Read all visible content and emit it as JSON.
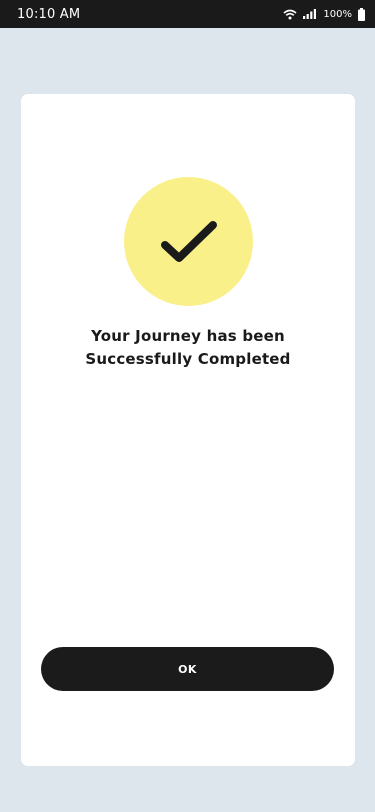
{
  "status_bar": {
    "time": "10:10 AM",
    "battery_percent": "100%",
    "icons": [
      "wifi-icon",
      "signal-icon",
      "battery-icon"
    ]
  },
  "card": {
    "icon": "checkmark-icon",
    "message_line1": "Your Journey has been",
    "message_line2": "Successfully Completed",
    "ok_label": "OK"
  },
  "colors": {
    "background": "#dde6ed",
    "card": "#ffffff",
    "accent_circle": "#faf08a",
    "button": "#1b1b1b",
    "status_bar": "#1a1a1a"
  }
}
